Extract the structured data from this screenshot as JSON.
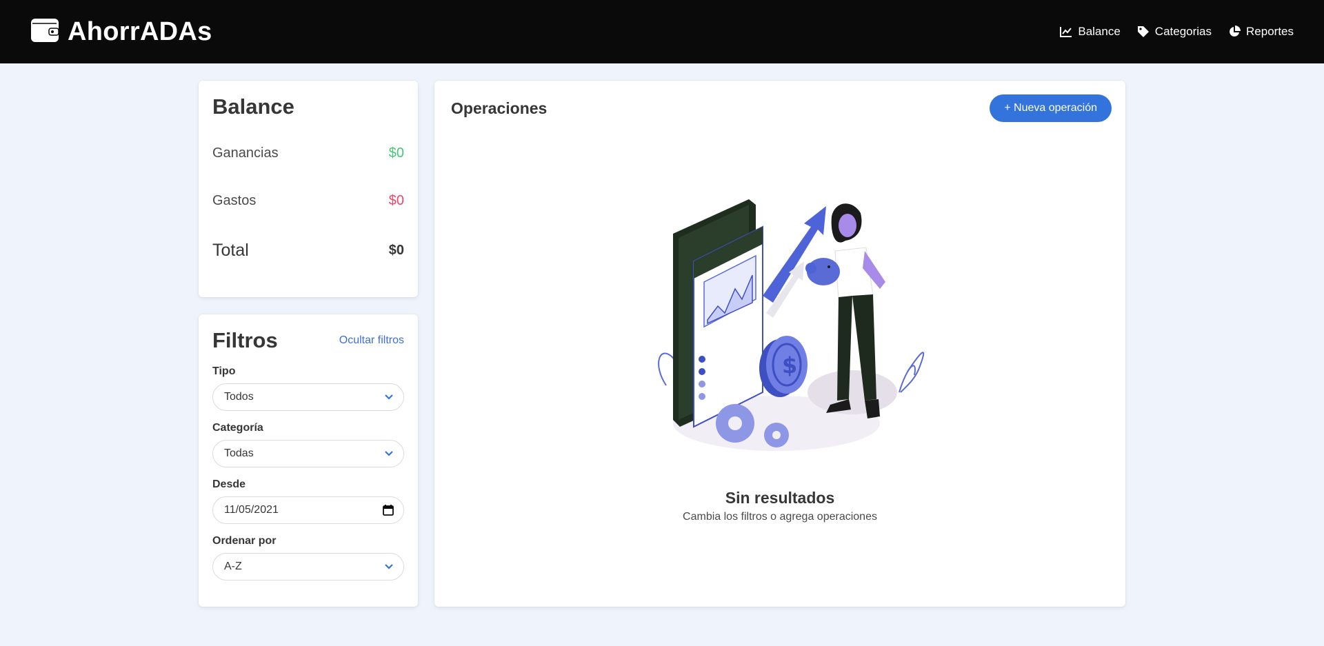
{
  "app": {
    "title": "AhorrADAs",
    "icon": "wallet-icon"
  },
  "nav": {
    "items": [
      {
        "label": "Balance",
        "icon": "chart-line-icon"
      },
      {
        "label": "Categorias",
        "icon": "tag-icon"
      },
      {
        "label": "Reportes",
        "icon": "pie-chart-icon"
      }
    ]
  },
  "balance": {
    "title": "Balance",
    "earnings_label": "Ganancias",
    "earnings_value": "$0",
    "expenses_label": "Gastos",
    "expenses_value": "$0",
    "total_label": "Total",
    "total_value": "$0"
  },
  "filters": {
    "title": "Filtros",
    "hide_label": "Ocultar filtros",
    "type_label": "Tipo",
    "type_value": "Todos",
    "category_label": "Categoría",
    "category_value": "Todas",
    "from_label": "Desde",
    "from_value": "11/05/2021",
    "order_label": "Ordenar por",
    "order_value": "A-Z"
  },
  "operations": {
    "title": "Operaciones",
    "new_button": "+ Nueva operación",
    "empty_title": "Sin resultados",
    "empty_subtitle": "Cambia los filtros o agrega operaciones"
  },
  "colors": {
    "navbar": "#0a0a0a",
    "primary": "#3273dc",
    "success": "#48c774",
    "danger": "#f14668",
    "background": "#eef3fc"
  }
}
